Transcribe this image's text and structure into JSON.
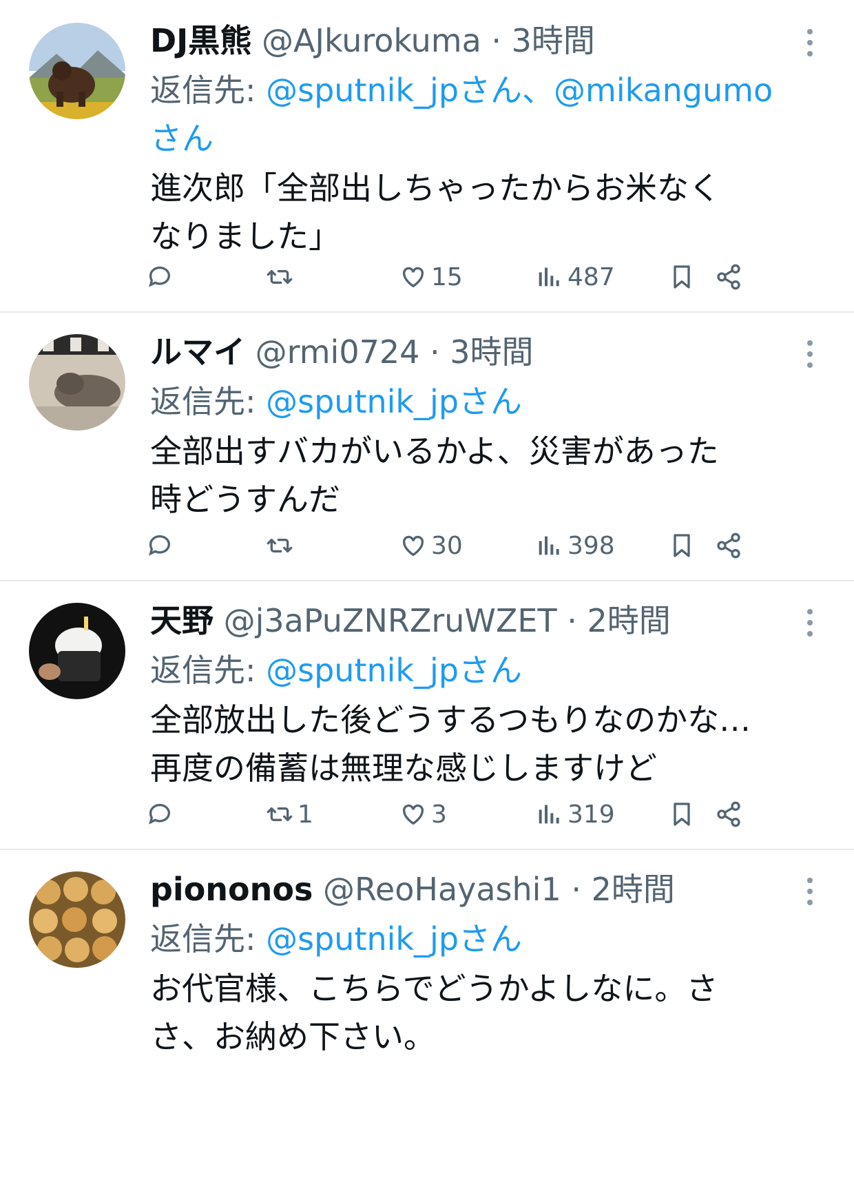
{
  "tweets": [
    {
      "name": "DJ黒熊",
      "handle": "@AJkurokuma",
      "time": "3時間",
      "reply_label": "返信先: ",
      "reply_mentions": "@sputnik_jpさん、@mikangumo",
      "reply_mentions_2": "さん",
      "body": [
        "進次郎「全部出しちゃったからお米なく",
        "なりました」"
      ],
      "reposts": "",
      "likes": "15",
      "views": "487"
    },
    {
      "name": "ルマイ",
      "handle": "@rmi0724",
      "time": "3時間",
      "reply_label": "返信先: ",
      "reply_mentions": "@sputnik_jpさん",
      "body": [
        "全部出すバカがいるかよ、災害があった",
        "時どうすんだ"
      ],
      "reposts": "",
      "likes": "30",
      "views": "398"
    },
    {
      "name": "天野",
      "handle": "@j3aPuZNRZruWZET",
      "time": "2時間",
      "reply_label": "返信先: ",
      "reply_mentions": "@sputnik_jpさん",
      "body": [
        "全部放出した後どうするつもりなのかな…",
        "再度の備蓄は無理な感じしますけど"
      ],
      "reposts": "1",
      "likes": "3",
      "views": "319"
    },
    {
      "name": "piononos",
      "handle": "@ReoHayashi1",
      "time": "2時間",
      "reply_label": "返信先: ",
      "reply_mentions": "@sputnik_jpさん",
      "body": [
        "お代官様、こちらでどうかよしなに。さ",
        "さ、お納め下さい。"
      ]
    }
  ],
  "icons": {
    "more": "more-vertical-icon",
    "reply": "reply-bubble-icon",
    "repost": "repost-arrows-icon",
    "like": "heart-icon",
    "views": "views-bars-icon",
    "bookmark": "bookmark-icon",
    "share": "share-icon"
  },
  "colors": {
    "mention": "#1d9bf0",
    "muted": "#536471",
    "text": "#0f1419"
  }
}
